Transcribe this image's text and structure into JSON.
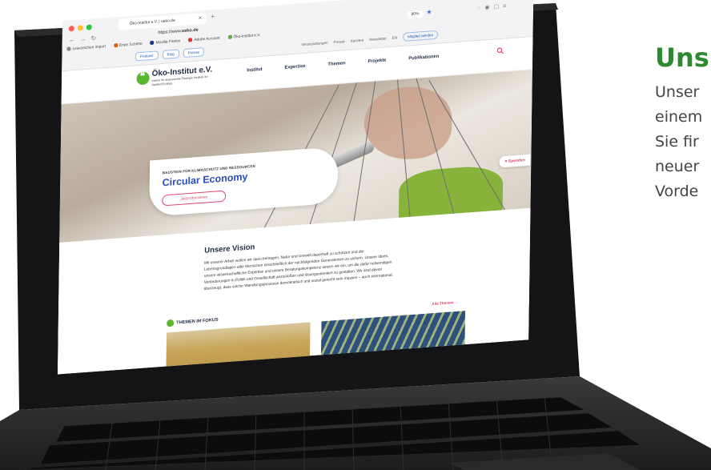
{
  "right_panel": {
    "title": "Uns",
    "lines": [
      "Unser",
      "einem",
      "Sie fir",
      "neuer",
      "Vorde"
    ]
  },
  "browser": {
    "tab_title": "Öko-Institut e.V. | oeko.de",
    "url_prefix": "https://www.",
    "url_domain": "oeko.de",
    "zoom": "90%",
    "bookmarks": [
      {
        "label": "Lesezeichen import",
        "color": "#888888"
      },
      {
        "label": "Erste Schritte",
        "color": "#e66000"
      },
      {
        "label": "Mozilla Firefox",
        "color": "#1b3a8a"
      },
      {
        "label": "Adobe Account",
        "color": "#e0302a"
      },
      {
        "label": "Öko-Institut e.V.",
        "color": "#5ab52f"
      }
    ]
  },
  "site": {
    "utility_left": [
      "Podcast",
      "Blog",
      "Presse"
    ],
    "utility_right": [
      "Veranstaltungen",
      "Presse",
      "Karriere",
      "Newsletter",
      "EN"
    ],
    "utility_cta": "Mitglied werden",
    "logo_title": "Öko-Institut e.V.",
    "logo_sub": "Institut für angewandte Ökologie Institute for Applied Ecology",
    "nav": [
      "Institut",
      "Expertise",
      "Themen",
      "Projekte",
      "Publikationen"
    ],
    "hero": {
      "kicker": "BAUSTEIN FÜR KLIMASCHUTZ UND RESSOURCEN",
      "title": "Circular Economy",
      "button": "Jetzt informieren"
    },
    "donate": "Spenden",
    "vision": {
      "title": "Unsere Vision",
      "text": "Mit unserer Arbeit wollen wir dazu beitragen, Natur und Umwelt dauerhaft zu schützen und die Lebensgrundlagen aller Menschen einschließlich der nachfolgenden Generationen zu sichern. Unsere Ideen, unsere wissenschaftliche Expertise und unsere Beratungskompetenz setzen wir ein, um die dafür notwendigen Veränderungen in Politik und Gesellschaft anzustoßen und lösungsorientiert zu gestalten. Wir sind davon überzeugt, dass solche Wandlungsprozesse demokratisch und sozial gerecht sein müssen – auch international."
    },
    "themen": {
      "heading": "THEMEN IM FOKUS",
      "link": "Alle Themen →"
    }
  },
  "colors": {
    "green": "#2c8a2f",
    "brand_green": "#5ab52f",
    "brand_blue": "#2a4db8",
    "accent_pink": "#e0466a"
  }
}
